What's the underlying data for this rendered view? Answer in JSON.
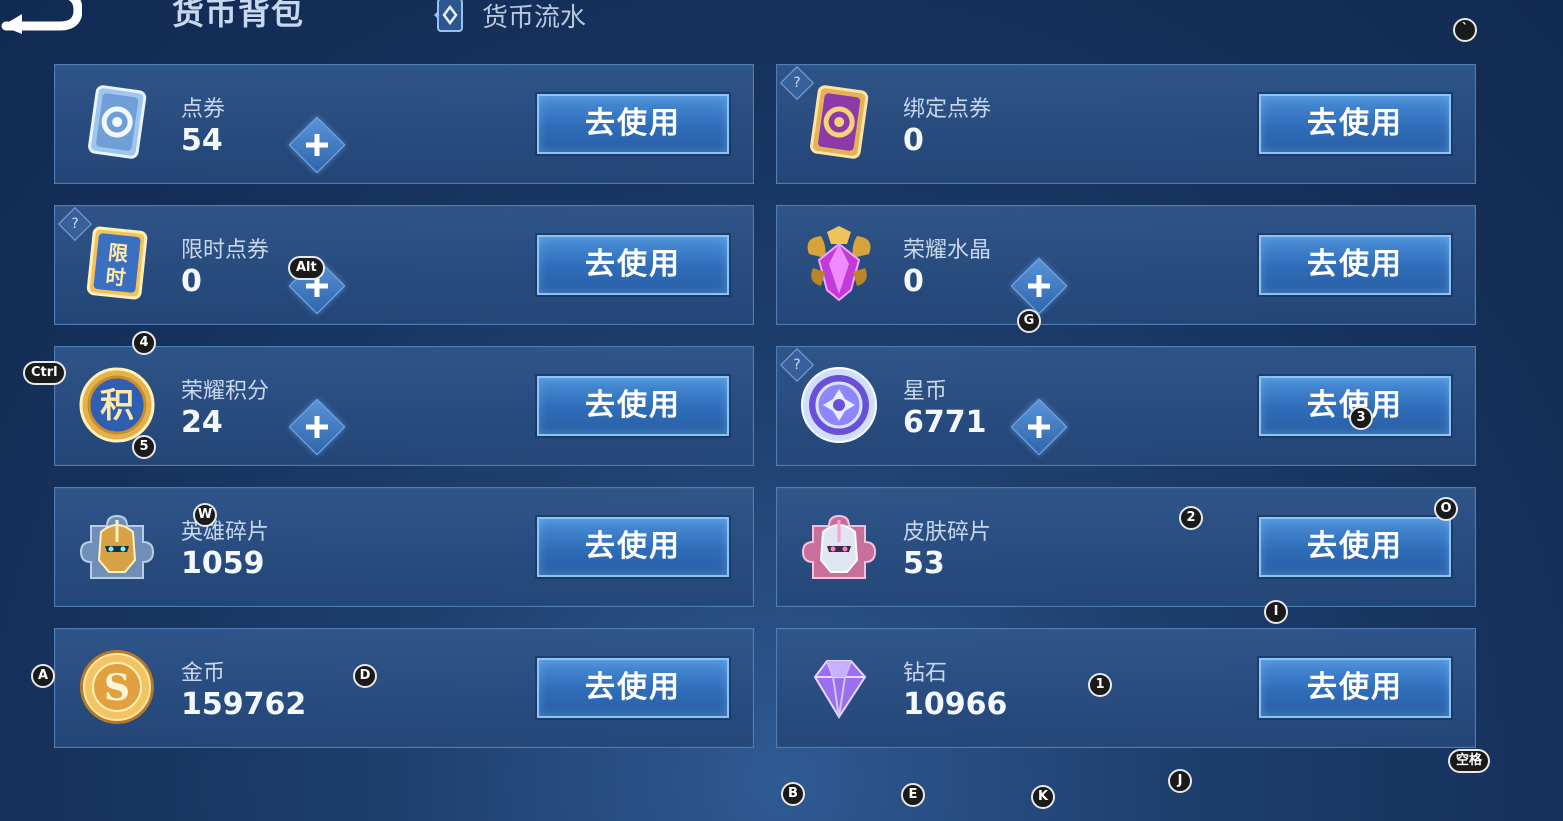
{
  "header": {
    "title": "货币背包",
    "flow_tab": "货币流水"
  },
  "button_label": "去使用",
  "help_glyph": "?",
  "currencies": [
    {
      "name": "点券",
      "amount": "54",
      "has_plus": true,
      "has_help": false,
      "icon": "coupon-card-icon"
    },
    {
      "name": "绑定点券",
      "amount": "0",
      "has_plus": false,
      "has_help": true,
      "icon": "bound-coupon-card-icon"
    },
    {
      "name": "限时点券",
      "amount": "0",
      "has_plus": true,
      "has_help": true,
      "icon": "limited-coupon-icon",
      "icon_text": "限时"
    },
    {
      "name": "荣耀水晶",
      "amount": "0",
      "has_plus": true,
      "has_help": false,
      "icon": "glory-crystal-icon"
    },
    {
      "name": "荣耀积分",
      "amount": "24",
      "has_plus": true,
      "has_help": false,
      "icon": "glory-points-icon",
      "icon_text": "积"
    },
    {
      "name": "星币",
      "amount": "6771",
      "has_plus": true,
      "has_help": true,
      "icon": "star-coin-icon"
    },
    {
      "name": "英雄碎片",
      "amount": "1059",
      "has_plus": false,
      "has_help": false,
      "icon": "hero-fragment-icon"
    },
    {
      "name": "皮肤碎片",
      "amount": "53",
      "has_plus": false,
      "has_help": false,
      "icon": "skin-fragment-icon"
    },
    {
      "name": "金币",
      "amount": "159762",
      "has_plus": false,
      "has_help": false,
      "icon": "gold-coin-icon",
      "icon_text": "S"
    },
    {
      "name": "钻石",
      "amount": "10966",
      "has_plus": false,
      "has_help": false,
      "icon": "diamond-icon"
    }
  ],
  "key_hints": [
    "`",
    "Alt",
    "4",
    "Ctrl",
    "5",
    "W",
    "G",
    "3",
    "2",
    "O",
    "I",
    "A",
    "D",
    "1",
    "空格",
    "B",
    "E",
    "K",
    "J"
  ],
  "colors": {
    "background": "#1a3764",
    "card": "#2b5189",
    "card_border": "#4d7bb4",
    "button": "#3a7bc8",
    "button_border": "#8cc4f6"
  }
}
